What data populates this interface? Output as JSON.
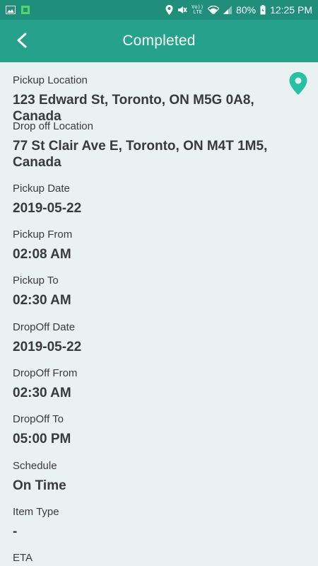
{
  "status_bar": {
    "battery": "80%",
    "time": "12:25 PM",
    "network_label": "LTE",
    "volte_label": "Vo))"
  },
  "app_bar": {
    "title": "Completed"
  },
  "fields": [
    {
      "label": "Pickup Location",
      "value": "123 Edward St, Toronto, ON M5G 0A8, Canada"
    },
    {
      "label": "Drop off Location",
      "value": "77 St Clair Ave E, Toronto, ON M4T 1M5, Canada"
    },
    {
      "label": "Pickup Date",
      "value": "2019-05-22"
    },
    {
      "label": "Pickup From",
      "value": "02:08 AM"
    },
    {
      "label": "Pickup To",
      "value": "02:30 AM"
    },
    {
      "label": "DropOff Date",
      "value": "2019-05-22"
    },
    {
      "label": "DropOff From",
      "value": "02:30 AM"
    },
    {
      "label": "DropOff To",
      "value": "05:00 PM"
    },
    {
      "label": "Schedule",
      "value": "On Time"
    },
    {
      "label": "Item Type",
      "value": "-"
    },
    {
      "label": "ETA",
      "value": ""
    }
  ],
  "colors": {
    "status_bar": "#1f8f7b",
    "app_bar": "#26a28c",
    "background": "#e9f1f1",
    "pin": "#26c1a4"
  },
  "icons": [
    "gallery-icon",
    "sim-icon",
    "location-icon",
    "mute-icon",
    "wifi-icon",
    "signal-icon",
    "battery-icon",
    "back-arrow-icon",
    "map-pin-icon"
  ]
}
